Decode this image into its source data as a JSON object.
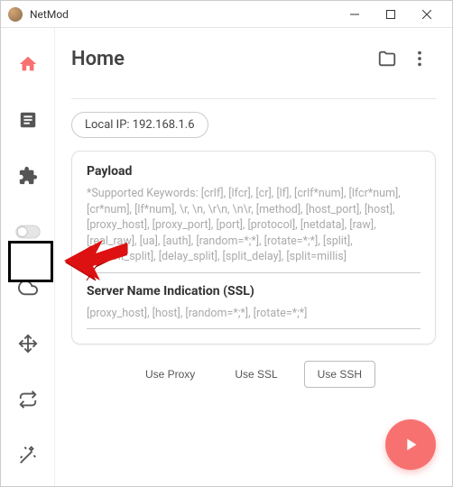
{
  "titlebar": {
    "app_name": "NetMod"
  },
  "header": {
    "title": "Home"
  },
  "local_ip_label": "Local IP: 192.168.1.6",
  "payload": {
    "title": "Payload",
    "placeholder": "*Supported Keywords: [crlf], [lfcr], [cr], [lf], [crlf*num], [lfcr*num], [cr*num], [lf*num], \\r, \\n, \\r\\n, \\n\\r, [method], [host_port], [host], [proxy_host], [proxy_port], [port], [protocol], [netdata], [raw], [real_raw], [ua], [auth], [random=*;*], [rotate=*;*], [split], [instant_split], [delay_split], [split_delay], [split=millis]"
  },
  "sni": {
    "title": "Server Name Indication (SSL)",
    "placeholder": "[proxy_host], [host], [random=*;*], [rotate=*;*]"
  },
  "buttons": {
    "use_proxy": "Use Proxy",
    "use_ssl": "Use SSL",
    "use_ssh": "Use SSH"
  },
  "sidebar": {
    "items": [
      {
        "name": "home"
      },
      {
        "name": "notes"
      },
      {
        "name": "extension"
      },
      {
        "name": "toggle"
      },
      {
        "name": "cloud"
      },
      {
        "name": "move"
      },
      {
        "name": "repeat"
      },
      {
        "name": "magic"
      }
    ]
  }
}
